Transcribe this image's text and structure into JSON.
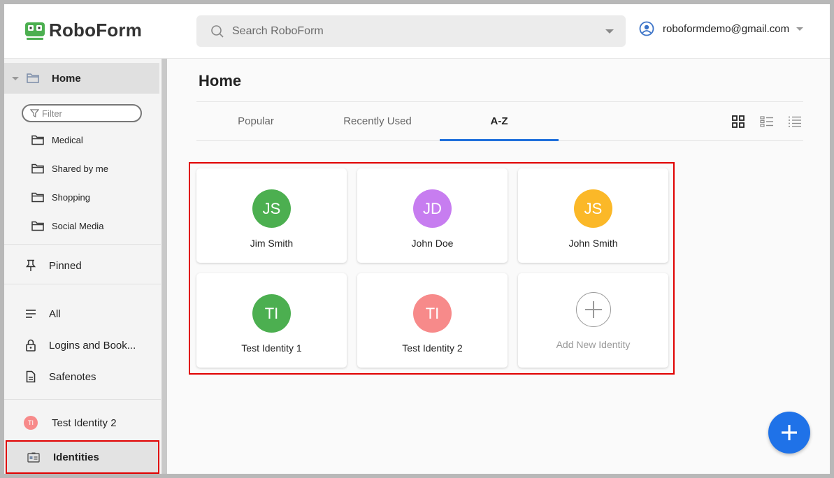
{
  "app": {
    "logo_text": "RoboForm",
    "brand_color": "#4caf50"
  },
  "search": {
    "placeholder": "Search RoboForm",
    "icon": "search-icon"
  },
  "account": {
    "email": "roboformdemo@gmail.com",
    "icon": "user-circle-icon"
  },
  "sidebar": {
    "home_label": "Home",
    "filter_placeholder": "Filter",
    "folders": [
      {
        "label": "Medical",
        "icon": "folder-icon"
      },
      {
        "label": "Shared by me",
        "icon": "folder-icon"
      },
      {
        "label": "Shopping",
        "icon": "folder-icon"
      },
      {
        "label": "Social Media",
        "icon": "folder-icon"
      }
    ],
    "pinned_label": "Pinned",
    "categories": [
      {
        "label": "All",
        "icon": "list-icon"
      },
      {
        "label": "Logins and Book...",
        "icon": "lock-icon"
      },
      {
        "label": "Safenotes",
        "icon": "note-icon"
      }
    ],
    "recent_identity": {
      "label": "Test Identity 2",
      "initials": "TI",
      "color": "#f78a8a"
    },
    "identities_label": "Identities"
  },
  "main": {
    "title": "Home",
    "tabs": [
      {
        "label": "Popular"
      },
      {
        "label": "Recently Used"
      },
      {
        "label": "A-Z",
        "active": true
      }
    ],
    "active_tab_color": "#1f6fdb",
    "view_modes": [
      "grid-view-icon",
      "list-view-icon",
      "compact-list-icon"
    ]
  },
  "identities": [
    {
      "name": "Jim Smith",
      "initials": "JS",
      "color": "#4caf50"
    },
    {
      "name": "John Doe",
      "initials": "JD",
      "color": "#c77df0"
    },
    {
      "name": "John Smith",
      "initials": "JS",
      "color": "#fbb828"
    },
    {
      "name": "Test Identity 1",
      "initials": "TI",
      "color": "#4caf50"
    },
    {
      "name": "Test Identity 2",
      "initials": "TI",
      "color": "#f78a8a"
    }
  ],
  "add_identity_label": "Add New Identity",
  "fab": {
    "icon": "plus-icon",
    "color": "#1f72e8"
  },
  "highlight_color": "#e00000"
}
